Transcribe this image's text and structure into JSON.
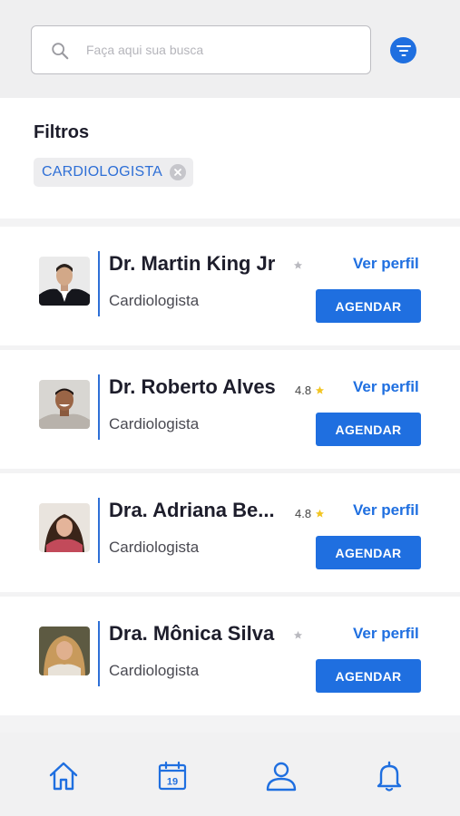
{
  "search": {
    "placeholder": "Faça aqui sua busca",
    "value": "",
    "icon": "search-icon"
  },
  "filters": {
    "title": "Filtros",
    "chips": [
      {
        "label": "CARDIOLOGISTA"
      }
    ]
  },
  "doctors": [
    {
      "name": "Dr. Martin King Jr",
      "rating": "",
      "specialty": "Cardiologista",
      "profile_label": "Ver perfil",
      "book_label": "AGENDAR"
    },
    {
      "name": "Dr. Roberto Alves",
      "rating": "4.8",
      "specialty": "Cardiologista",
      "profile_label": "Ver perfil",
      "book_label": "AGENDAR"
    },
    {
      "name": "Dra. Adriana Be...",
      "rating": "4.8",
      "specialty": "Cardiologista",
      "profile_label": "Ver perfil",
      "book_label": "AGENDAR"
    },
    {
      "name": "Dra. Mônica Silva",
      "rating": "",
      "specialty": "Cardiologista",
      "profile_label": "Ver perfil",
      "book_label": "AGENDAR"
    }
  ],
  "nav": {
    "calendar_day": "19"
  },
  "colors": {
    "accent": "#1f6fe0",
    "star_filled": "#f2c522",
    "star_empty": "#b9b9bf"
  }
}
